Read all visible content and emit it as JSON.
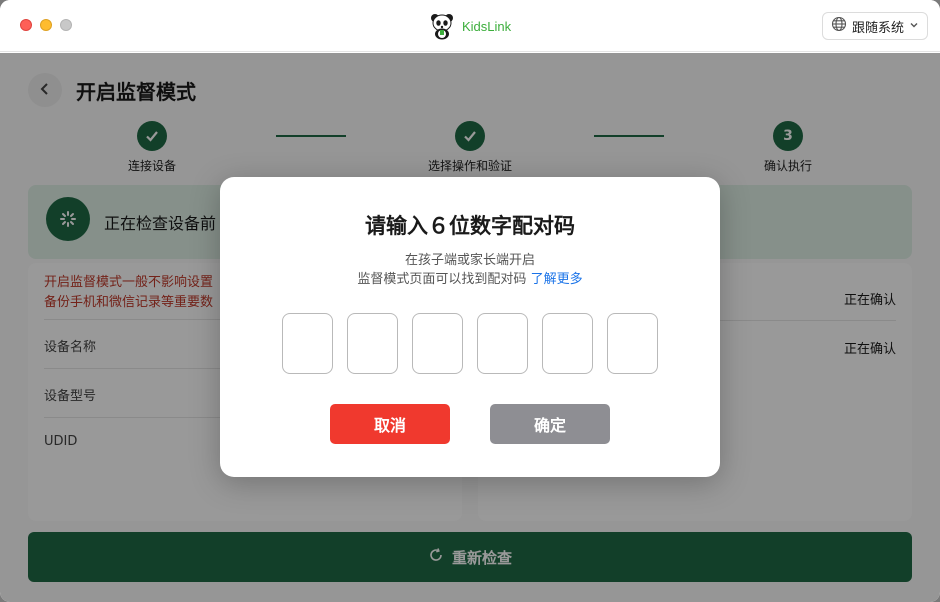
{
  "app": {
    "name": "KidsLink"
  },
  "titlebar": {
    "language_label": "跟随系统"
  },
  "page": {
    "title": "开启监督模式"
  },
  "steps": [
    {
      "label": "连接设备",
      "state": "done",
      "number": ""
    },
    {
      "label": "选择操作和验证",
      "state": "done",
      "number": ""
    },
    {
      "label": "确认执行",
      "state": "current",
      "number": "3"
    }
  ],
  "banner": {
    "text": "正在检查设备前"
  },
  "left_card": {
    "warning": "开启监督模式一般不影响设置\n备份手机和微信记录等重要数",
    "fields": [
      "设备名称",
      "设备型号",
      "UDID"
    ]
  },
  "right_card": {
    "rows": [
      {
        "value": "正在确认"
      },
      {
        "value": "正在确认"
      }
    ]
  },
  "recheck_button": {
    "label": "重新检查"
  },
  "modal": {
    "title": "请输入６位数字配对码",
    "subtitle_line1": "在孩子端或家长端开启",
    "subtitle_line2": "监督模式页面可以找到配对码",
    "learn_more": "了解更多",
    "code_length": 6,
    "cancel_label": "取消",
    "confirm_label": "确定"
  },
  "colors": {
    "brand_green": "#1f6a45",
    "banner_bg": "#dff0e7",
    "warning_red": "#c0392b",
    "cancel_red": "#f0392e",
    "confirm_disabled_gray": "#8e8e93",
    "link_blue": "#1a73e8"
  },
  "icons": {
    "back": "chevron-left-icon",
    "language": "globe-icon",
    "language_caret": "chevron-down-icon",
    "step_done": "checkmark-icon",
    "banner_spinner": "loading-spinner-icon",
    "recheck": "refresh-icon",
    "app_logo": "panda-logo-icon"
  }
}
